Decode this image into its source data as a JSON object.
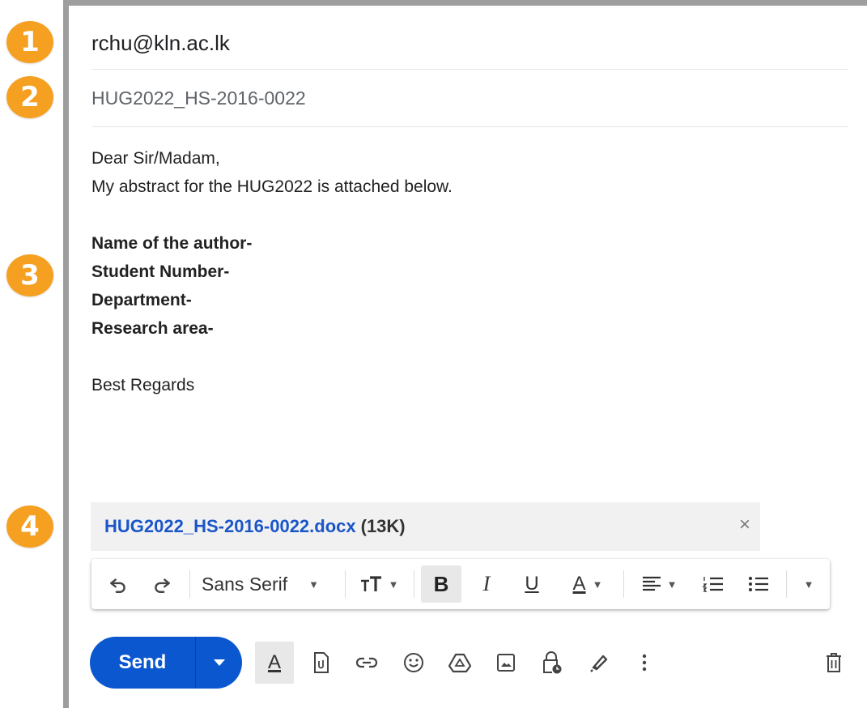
{
  "badges": [
    "1",
    "2",
    "3",
    "4"
  ],
  "compose": {
    "to": "rchu@kln.ac.lk",
    "subject": "HUG2022_HS-2016-0022",
    "body": {
      "greeting": "Dear Sir/Madam,",
      "intro": "My abstract for the HUG2022 is attached below.",
      "fields": [
        "Name of the author-",
        "Student Number-",
        "Department-",
        "Research area-"
      ],
      "closing": "Best Regards"
    }
  },
  "attachment": {
    "name": "HUG2022_HS-2016-0022.docx",
    "size": "(13K)",
    "close": "×"
  },
  "formatting": {
    "font": "Sans Serif",
    "bold": "B",
    "italic": "I",
    "underline": "U",
    "text_color": "A"
  },
  "actions": {
    "send_label": "Send",
    "text_format_glyph": "A"
  },
  "colors": {
    "badge": "#f5a021",
    "send": "#0b57d0",
    "link": "#1a56c8"
  }
}
